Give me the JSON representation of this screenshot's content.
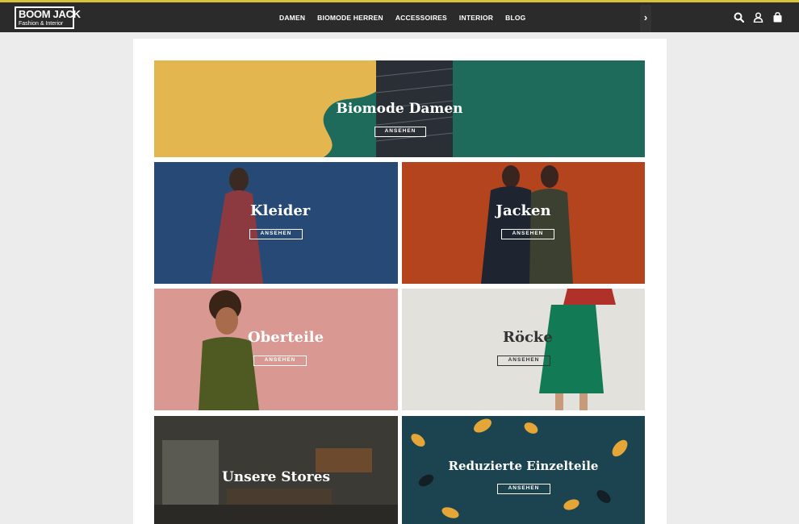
{
  "header": {
    "logo_line1": "BOOM JACK",
    "logo_line2": "Fashion & Interior",
    "nav": [
      "DAMEN",
      "BIOMODE HERREN",
      "ACCESSOIRES",
      "INTERIOR",
      "BLOG"
    ],
    "icons": [
      "search-icon",
      "account-icon",
      "cart-icon",
      "chevron-right-icon"
    ]
  },
  "tiles": {
    "hero": {
      "title": "Biomode Damen",
      "button": "ANSEHEN"
    },
    "kleider": {
      "title": "Kleider",
      "button": "ANSEHEN"
    },
    "jacken": {
      "title": "Jacken",
      "button": "ANSEHEN"
    },
    "oberteile": {
      "title": "Oberteile",
      "button": "ANSEHEN"
    },
    "roecke": {
      "title": "Röcke",
      "button": "ANSEHEN"
    },
    "stores": {
      "title": "Unsere Stores"
    },
    "reduziert": {
      "title": "Reduzierte Einzelteile",
      "button": "ANSEHEN"
    }
  },
  "colors": {
    "header_bg": "#2b2b2b",
    "accent_top": "#d9c23a",
    "hero_green": "#1e6b5b",
    "hero_yellow": "#e4b64f"
  }
}
